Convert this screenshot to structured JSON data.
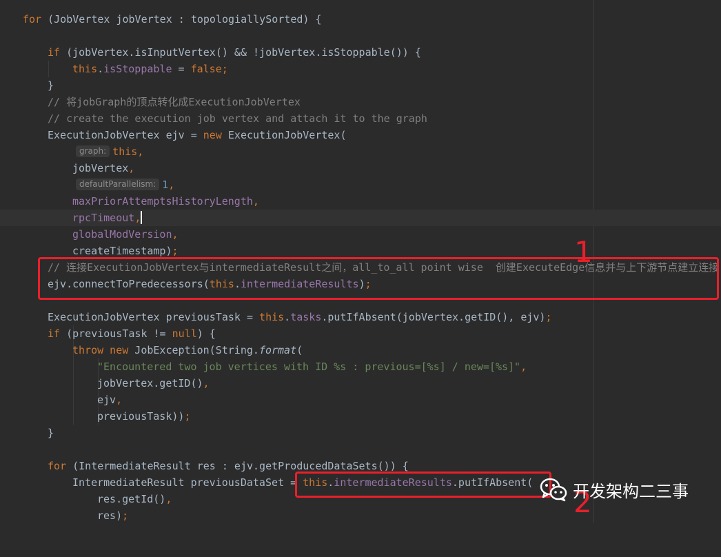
{
  "code": {
    "l01": {
      "kw1": "for",
      "rest": " (JobVertex jobVertex : topologiallySorted) {"
    },
    "l03": {
      "kw1": "if",
      "t1": " (jobVertex.isInputVertex() && !jobVertex.isStoppable()) {"
    },
    "l04": {
      "kw1": "this",
      "t1": ".",
      "f1": "isStoppable",
      "t2": " = ",
      "kw2": "false",
      "t3": ";"
    },
    "l05": {
      "t1": "}"
    },
    "l06": {
      "c": "// 将jobGraph的顶点转化成ExecutionJobVertex"
    },
    "l07": {
      "c": "// create the execution job vertex and attach it to the graph"
    },
    "l08": {
      "t1": "ExecutionJobVertex ejv = ",
      "kw1": "new",
      "t2": " ExecutionJobVertex("
    },
    "l09": {
      "hint": "graph:",
      "kw1": "this",
      "kw2": ","
    },
    "l10": {
      "t1": "jobVertex",
      "kw1": ","
    },
    "l11": {
      "hint": "defaultParallelism:",
      "n1": "1",
      "kw1": ","
    },
    "l12": {
      "f1": "maxPriorAttemptsHistoryLength",
      "kw1": ","
    },
    "l13": {
      "f1": "rpcTimeout",
      "kw1": ","
    },
    "l14": {
      "f1": "globalModVersion",
      "kw1": ","
    },
    "l15": {
      "t1": "createTimestamp)",
      "kw1": ";"
    },
    "l16": {
      "c": "// 连接ExecutionJobVertex与intermediateResult之间，all_to_all point wise  创建ExecuteEdge信息并与上下游节点建立连接"
    },
    "l17": {
      "t1": "ejv.connectToPredecessors(",
      "kw1": "this",
      "t2": ".",
      "f1": "intermediateResults",
      "t3": ")",
      "kw2": ";"
    },
    "l19": {
      "t1": "ExecutionJobVertex previousTask = ",
      "kw1": "this",
      "t2": ".",
      "f1": "tasks",
      "t3": ".putIfAbsent(jobVertex.getID(), ejv)",
      "kw2": ";"
    },
    "l20": {
      "kw1": "if",
      "t1": " (previousTask != ",
      "kw2": "null",
      "t2": ") {"
    },
    "l21": {
      "kw1": "throw new",
      "t1": " JobException(String.",
      "i1": "format",
      "t2": "("
    },
    "l22": {
      "s1": "\"Encountered two job vertices with ID %s : previous=[%s] / new=[%s]\"",
      "kw1": ","
    },
    "l23": {
      "t1": "jobVertex.getID()",
      "kw1": ","
    },
    "l24": {
      "t1": "ejv",
      "kw1": ","
    },
    "l25": {
      "t1": "previousTask))",
      "kw1": ";"
    },
    "l26": {
      "t1": "}"
    },
    "l28": {
      "kw1": "for",
      "t1": " (IntermediateResult res : ejv.getProducedDataSets()) {"
    },
    "l29": {
      "t1": "IntermediateResult previousDataSet = ",
      "kw1": "this",
      "t2": ".",
      "f1": "intermediateResults",
      "t3": ".putIfAbsent("
    },
    "l30": {
      "t1": "res.getId()",
      "kw1": ","
    },
    "l31": {
      "t1": "res)",
      "kw1": ";"
    }
  },
  "annotations": {
    "one": "1",
    "two": "2"
  },
  "watermark": {
    "text": "开发架构二三事",
    "icon": "wechat-icon"
  },
  "colors": {
    "background": "#2b2b2b",
    "keyword": "#cc7832",
    "field": "#9876aa",
    "comment": "#808080",
    "string": "#6a8759",
    "number": "#6897bb",
    "annotation": "#e8202a"
  }
}
